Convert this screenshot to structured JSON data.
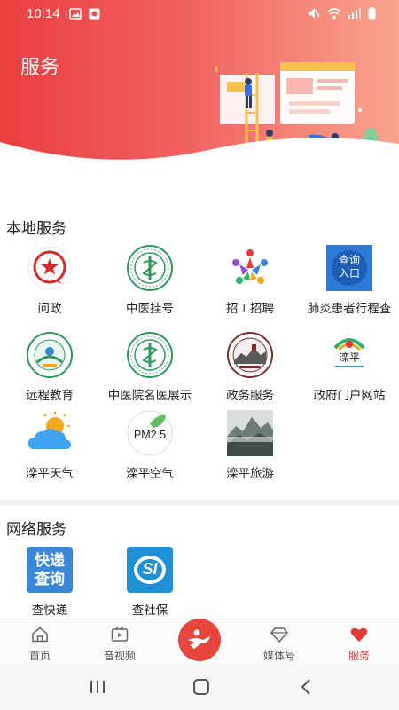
{
  "status_bar": {
    "time": "10:14"
  },
  "header": {
    "title": "服务"
  },
  "local_services": {
    "title": "本地服务",
    "items": [
      {
        "label": "问政",
        "icon": "wenzheng-star-icon"
      },
      {
        "label": "中医挂号",
        "icon": "tcm-hospital-logo-icon"
      },
      {
        "label": "招工招聘",
        "icon": "recruitment-people-icon"
      },
      {
        "label": "肺炎患者行程查",
        "icon": "query-entry-icon",
        "icon_text_1": "查询",
        "icon_text_2": "入口"
      },
      {
        "label": "远程教育",
        "icon": "remote-education-logo-icon"
      },
      {
        "label": "中医院名医展示",
        "icon": "tcm-doctors-logo-icon"
      },
      {
        "label": "政务服务",
        "icon": "great-wall-badge-icon"
      },
      {
        "label": "政府门户网站",
        "icon": "government-portal-icon",
        "icon_text": "滦平"
      },
      {
        "label": "滦平天气",
        "icon": "weather-sun-cloud-icon"
      },
      {
        "label": "滦平空气",
        "icon": "pm25-leaf-icon",
        "icon_text": "PM2.5"
      },
      {
        "label": "滦平旅游",
        "icon": "mountain-landscape-icon"
      }
    ]
  },
  "network_services": {
    "title": "网络服务",
    "items": [
      {
        "label": "查快递",
        "icon": "express-query-icon",
        "icon_text_1": "快递",
        "icon_text_2": "查询"
      },
      {
        "label": "查社保",
        "icon": "social-security-icon",
        "icon_text": "SI"
      }
    ]
  },
  "bottom_nav": {
    "items": [
      {
        "label": "首页",
        "icon": "home-icon"
      },
      {
        "label": "音视频",
        "icon": "video-icon"
      },
      {
        "label": "媒体号",
        "icon": "diamond-icon"
      },
      {
        "label": "服务",
        "icon": "heart-icon",
        "active": true
      }
    ],
    "center_icon": "center-logo-icon"
  },
  "colors": {
    "accent": "#e33a35",
    "header_start": "#ea3f3f",
    "header_end": "#f8a48e"
  }
}
